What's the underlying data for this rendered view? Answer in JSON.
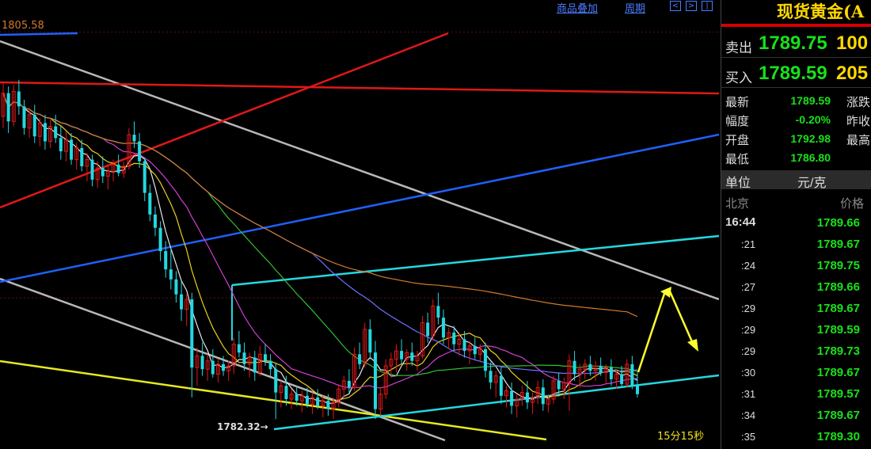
{
  "toolbar": {
    "overlay_label": "商品叠加",
    "period_label": "周期",
    "nav_left": "<",
    "nav_right": ">",
    "nav_end": "|"
  },
  "chart_data": {
    "type": "candlestick",
    "high_label": "1805.58",
    "low_label": "1782.32",
    "timer_label": "15分15秒",
    "ylim": [
      1780.5,
      1807.5
    ],
    "candles": [
      [
        1800.5,
        1802.6,
        1799.8,
        1801.9
      ],
      [
        1801.9,
        1802.3,
        1799.5,
        1800.2
      ],
      [
        1800.2,
        1802.4,
        1799.9,
        1802.0
      ],
      [
        1802.0,
        1802.7,
        1800.6,
        1801.1
      ],
      [
        1801.1,
        1801.5,
        1799.4,
        1799.8
      ],
      [
        1799.8,
        1801.0,
        1799.2,
        1800.6
      ],
      [
        1800.6,
        1801.2,
        1798.9,
        1799.3
      ],
      [
        1799.3,
        1800.4,
        1798.7,
        1800.1
      ],
      [
        1800.1,
        1800.6,
        1798.5,
        1799.0
      ],
      [
        1799.0,
        1800.3,
        1798.6,
        1799.9
      ],
      [
        1799.9,
        1800.6,
        1798.9,
        1799.2
      ],
      [
        1799.2,
        1799.9,
        1797.9,
        1798.4
      ],
      [
        1798.4,
        1799.6,
        1797.8,
        1799.1
      ],
      [
        1799.1,
        1799.5,
        1797.6,
        1797.9
      ],
      [
        1797.9,
        1798.9,
        1797.3,
        1798.6
      ],
      [
        1798.6,
        1799.1,
        1797.2,
        1797.5
      ],
      [
        1797.5,
        1798.3,
        1796.6,
        1797.9
      ],
      [
        1797.9,
        1798.2,
        1796.3,
        1796.7
      ],
      [
        1796.7,
        1797.8,
        1796.2,
        1797.4
      ],
      [
        1797.4,
        1798.1,
        1796.5,
        1796.9
      ],
      [
        1796.9,
        1797.6,
        1796.1,
        1797.2
      ],
      [
        1797.2,
        1797.9,
        1796.6,
        1797.6
      ],
      [
        1797.6,
        1798.2,
        1796.9,
        1797.1
      ],
      [
        1797.1,
        1797.8,
        1796.8,
        1797.5
      ],
      [
        1797.5,
        1799.8,
        1797.3,
        1799.4
      ],
      [
        1799.4,
        1800.2,
        1798.6,
        1799.0
      ],
      [
        1799.0,
        1799.5,
        1797.4,
        1797.8
      ],
      [
        1797.8,
        1798.0,
        1795.4,
        1795.9
      ],
      [
        1795.9,
        1796.4,
        1794.2,
        1794.6
      ],
      [
        1794.6,
        1795.1,
        1793.3,
        1793.8
      ],
      [
        1793.8,
        1794.2,
        1791.8,
        1792.4
      ],
      [
        1792.4,
        1793.0,
        1790.8,
        1791.3
      ],
      [
        1791.3,
        1792.6,
        1790.1,
        1790.7
      ],
      [
        1790.7,
        1791.2,
        1789.3,
        1789.8
      ],
      [
        1789.8,
        1790.6,
        1788.2,
        1788.9
      ],
      [
        1788.9,
        1789.8,
        1787.9,
        1789.5
      ],
      [
        1789.5,
        1789.9,
        1783.6,
        1785.4
      ],
      [
        1785.4,
        1786.6,
        1784.3,
        1786.1
      ],
      [
        1786.1,
        1786.9,
        1784.9,
        1785.3
      ],
      [
        1785.3,
        1786.2,
        1784.6,
        1785.8
      ],
      [
        1785.8,
        1786.5,
        1784.8,
        1785.0
      ],
      [
        1785.0,
        1785.9,
        1784.5,
        1785.6
      ],
      [
        1785.6,
        1786.1,
        1784.9,
        1785.2
      ],
      [
        1785.2,
        1785.8,
        1784.6,
        1785.5
      ],
      [
        1785.5,
        1787.2,
        1785.0,
        1786.8
      ],
      [
        1786.8,
        1787.6,
        1786.0,
        1786.3
      ],
      [
        1786.3,
        1786.9,
        1785.2,
        1785.6
      ],
      [
        1785.6,
        1786.3,
        1784.8,
        1786.0
      ],
      [
        1786.0,
        1786.4,
        1784.6,
        1785.1
      ],
      [
        1785.1,
        1786.7,
        1784.9,
        1786.2
      ],
      [
        1786.2,
        1786.8,
        1785.5,
        1785.8
      ],
      [
        1785.8,
        1786.2,
        1784.9,
        1785.3
      ],
      [
        1785.3,
        1785.7,
        1782.3,
        1783.9
      ],
      [
        1783.9,
        1784.6,
        1783.0,
        1784.3
      ],
      [
        1784.3,
        1784.9,
        1783.1,
        1783.5
      ],
      [
        1783.5,
        1784.1,
        1782.9,
        1783.8
      ],
      [
        1783.8,
        1784.3,
        1783.1,
        1783.4
      ],
      [
        1783.4,
        1784.0,
        1782.7,
        1783.7
      ],
      [
        1783.7,
        1784.2,
        1783.0,
        1783.2
      ],
      [
        1783.2,
        1783.9,
        1782.6,
        1783.6
      ],
      [
        1783.6,
        1784.1,
        1782.9,
        1783.1
      ],
      [
        1783.1,
        1783.7,
        1782.4,
        1783.4
      ],
      [
        1783.4,
        1783.8,
        1782.5,
        1782.9
      ],
      [
        1782.9,
        1783.6,
        1782.3,
        1783.3
      ],
      [
        1783.3,
        1784.4,
        1783.0,
        1784.1
      ],
      [
        1784.1,
        1784.9,
        1783.6,
        1784.6
      ],
      [
        1784.6,
        1785.3,
        1783.9,
        1784.2
      ],
      [
        1784.2,
        1786.6,
        1784.0,
        1786.2
      ],
      [
        1786.2,
        1786.9,
        1785.3,
        1785.6
      ],
      [
        1785.6,
        1788.1,
        1785.4,
        1787.7
      ],
      [
        1787.7,
        1788.3,
        1785.9,
        1786.3
      ],
      [
        1786.3,
        1787.0,
        1782.3,
        1782.9
      ],
      [
        1782.9,
        1784.2,
        1782.5,
        1783.8
      ],
      [
        1783.8,
        1785.9,
        1783.5,
        1785.5
      ],
      [
        1785.5,
        1786.3,
        1784.8,
        1785.9
      ],
      [
        1785.9,
        1786.8,
        1785.1,
        1786.4
      ],
      [
        1786.4,
        1787.1,
        1785.6,
        1785.9
      ],
      [
        1785.9,
        1786.5,
        1785.2,
        1786.3
      ],
      [
        1786.3,
        1786.9,
        1785.5,
        1785.8
      ],
      [
        1785.8,
        1786.4,
        1785.2,
        1786.1
      ],
      [
        1786.1,
        1788.5,
        1785.9,
        1788.1
      ],
      [
        1788.1,
        1788.7,
        1786.9,
        1787.3
      ],
      [
        1787.3,
        1789.5,
        1787.0,
        1789.1
      ],
      [
        1789.1,
        1789.9,
        1788.0,
        1788.4
      ],
      [
        1788.4,
        1788.9,
        1786.8,
        1787.2
      ],
      [
        1787.2,
        1787.8,
        1786.5,
        1787.5
      ],
      [
        1787.5,
        1787.9,
        1786.4,
        1786.8
      ],
      [
        1786.8,
        1787.4,
        1786.1,
        1787.1
      ],
      [
        1787.1,
        1787.6,
        1786.0,
        1786.4
      ],
      [
        1786.4,
        1787.0,
        1785.6,
        1786.7
      ],
      [
        1786.7,
        1787.2,
        1785.9,
        1786.2
      ],
      [
        1786.2,
        1786.8,
        1785.7,
        1786.5
      ],
      [
        1786.5,
        1786.9,
        1784.8,
        1785.2
      ],
      [
        1785.2,
        1785.7,
        1784.1,
        1784.5
      ],
      [
        1784.5,
        1785.2,
        1783.6,
        1784.9
      ],
      [
        1784.9,
        1785.4,
        1783.2,
        1783.7
      ],
      [
        1783.7,
        1784.3,
        1783.0,
        1784.0
      ],
      [
        1784.0,
        1784.5,
        1782.6,
        1783.1
      ],
      [
        1783.1,
        1783.8,
        1782.4,
        1783.5
      ],
      [
        1783.5,
        1784.3,
        1783.1,
        1783.9
      ],
      [
        1783.9,
        1784.6,
        1782.9,
        1783.3
      ],
      [
        1783.3,
        1783.9,
        1782.6,
        1783.6
      ],
      [
        1783.6,
        1784.6,
        1783.2,
        1784.2
      ],
      [
        1784.2,
        1784.7,
        1782.8,
        1783.2
      ],
      [
        1783.2,
        1783.8,
        1782.7,
        1783.5
      ],
      [
        1783.5,
        1784.9,
        1783.2,
        1784.6
      ],
      [
        1784.6,
        1785.1,
        1783.8,
        1784.1
      ],
      [
        1784.1,
        1784.8,
        1783.5,
        1784.5
      ],
      [
        1784.5,
        1786.2,
        1782.8,
        1785.8
      ],
      [
        1785.8,
        1786.4,
        1784.6,
        1785.0
      ],
      [
        1785.0,
        1785.6,
        1784.2,
        1785.3
      ],
      [
        1785.3,
        1785.9,
        1784.7,
        1785.6
      ],
      [
        1785.6,
        1786.1,
        1784.9,
        1785.2
      ],
      [
        1785.2,
        1785.8,
        1784.6,
        1785.5
      ],
      [
        1785.5,
        1786.0,
        1784.9,
        1785.1
      ],
      [
        1785.1,
        1785.6,
        1784.4,
        1785.4
      ],
      [
        1785.4,
        1785.9,
        1784.3,
        1784.7
      ],
      [
        1784.7,
        1785.3,
        1784.1,
        1785.0
      ],
      [
        1785.0,
        1785.5,
        1784.2,
        1784.4
      ],
      [
        1784.4,
        1785.9,
        1784.2,
        1785.6
      ],
      [
        1785.6,
        1786.1,
        1784.1,
        1784.3
      ],
      [
        1784.3,
        1785.1,
        1783.6,
        1783.8
      ]
    ],
    "quote": {
      "title": "现货黄金(A",
      "sell_label": "卖出",
      "sell_price": "1789.75",
      "sell_qty": "100",
      "buy_label": "买入",
      "buy_price": "1789.59",
      "buy_qty": "205",
      "info": [
        {
          "k1": "最新",
          "v1": "1789.59",
          "k2": "涨跌"
        },
        {
          "k1": "幅度",
          "v1": "-0.20%",
          "k2": "昨收"
        },
        {
          "k1": "开盘",
          "v1": "1792.98",
          "k2": "最高"
        },
        {
          "k1": "最低",
          "v1": "1786.80",
          "k2": ""
        }
      ],
      "unit_label": "单位",
      "unit_value": "元/克",
      "tick_col_time": "北京",
      "tick_col_price": "价格",
      "ticks": [
        {
          "time": "16:44",
          "price": "1789.66"
        },
        {
          "time": ":21",
          "price": "1789.67"
        },
        {
          "time": ":24",
          "price": "1789.75"
        },
        {
          "time": ":27",
          "price": "1789.66"
        },
        {
          "time": ":29",
          "price": "1789.67"
        },
        {
          "time": ":29",
          "price": "1789.59"
        },
        {
          "time": ":29",
          "price": "1789.73"
        },
        {
          "time": ":30",
          "price": "1789.67"
        },
        {
          "time": ":31",
          "price": "1789.57"
        },
        {
          "time": ":34",
          "price": "1789.67"
        },
        {
          "time": ":35",
          "price": "1789.30"
        }
      ]
    }
  },
  "colors": {
    "up": "#e01818",
    "down": "#25d8e0",
    "background": "#000000",
    "price_green": "#19e019",
    "title_yellow": "#ffd800",
    "trend_cyan": "#25d8e0",
    "trend_red": "#e01818",
    "trend_blue": "#2060ff",
    "trend_gray": "#b8b8b8",
    "trend_yellow": "#e8e820"
  },
  "icons": [
    "nav-left-icon",
    "nav-right-icon",
    "nav-end-icon",
    "arrow-up-icon",
    "arrow-down-icon"
  ]
}
